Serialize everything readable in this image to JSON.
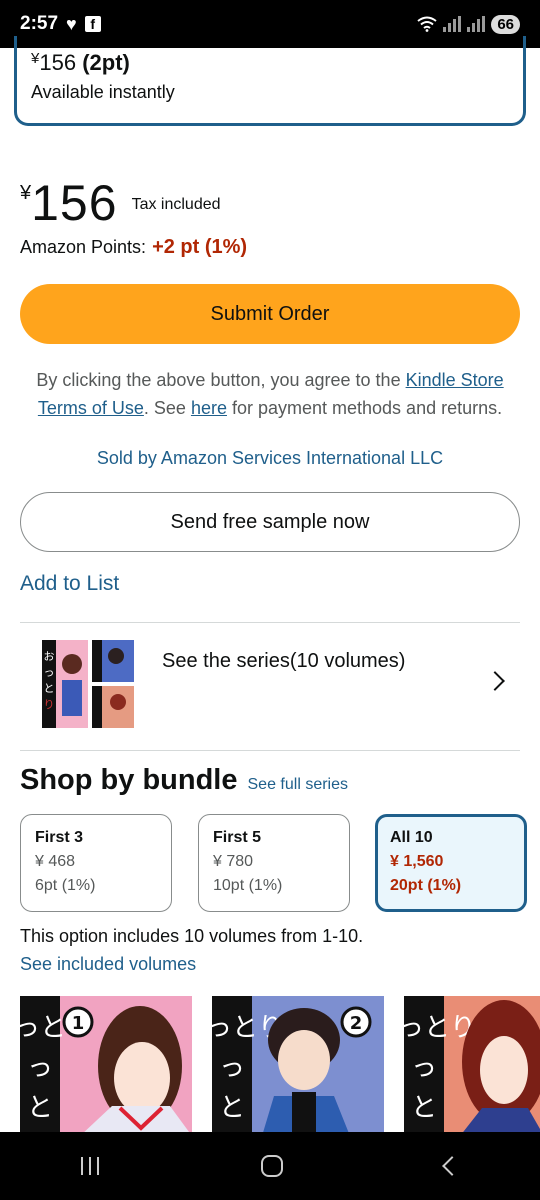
{
  "status_bar": {
    "time": "2:57",
    "battery": "66"
  },
  "top_card": {
    "yen": "¥",
    "price": "156",
    "points": "(2pt)",
    "availability": "Available instantly"
  },
  "price": {
    "yen": "¥",
    "amount": "156",
    "tax": "Tax included"
  },
  "points": {
    "label": "Amazon Points:",
    "value": "+2 pt (1%)"
  },
  "submit_button": "Submit Order",
  "terms": {
    "part1": "By clicking the above button, you agree to the ",
    "link1": "Kindle Store Terms of Use",
    "part2": ". See ",
    "link2": "here",
    "part3": " for payment methods and returns."
  },
  "sold_by": "Sold by Amazon Services International LLC",
  "sample_button": "Send free sample now",
  "add_to_list": "Add to List",
  "series": {
    "label": "See the series(10 volumes)"
  },
  "bundle": {
    "heading": "Shop by bundle",
    "see_full": "See full series",
    "options": [
      {
        "title": "First 3",
        "price": "¥ 468",
        "points": "6pt (1%)"
      },
      {
        "title": "First 5",
        "price": "¥ 780",
        "points": "10pt (1%)"
      },
      {
        "title": "All 10",
        "price": "¥ 1,560",
        "points": "20pt (1%)",
        "selected": true
      }
    ],
    "option_text": "This option includes 10 volumes from 1-10.",
    "see_included": "See included volumes"
  },
  "covers": {
    "cover1": {
      "title_char": "おっとり",
      "number": "1",
      "bg": "#f1a3c1"
    },
    "cover2": {
      "title_char": "おっとり",
      "number": "2",
      "bg": "#7d8fd0"
    },
    "cover3": {
      "title_char": "おっとり",
      "number": "",
      "bg": "#e98d75"
    }
  },
  "colors": {
    "accent": "#ffa41c",
    "link": "#1f5f8b",
    "price_red": "#b12704"
  }
}
